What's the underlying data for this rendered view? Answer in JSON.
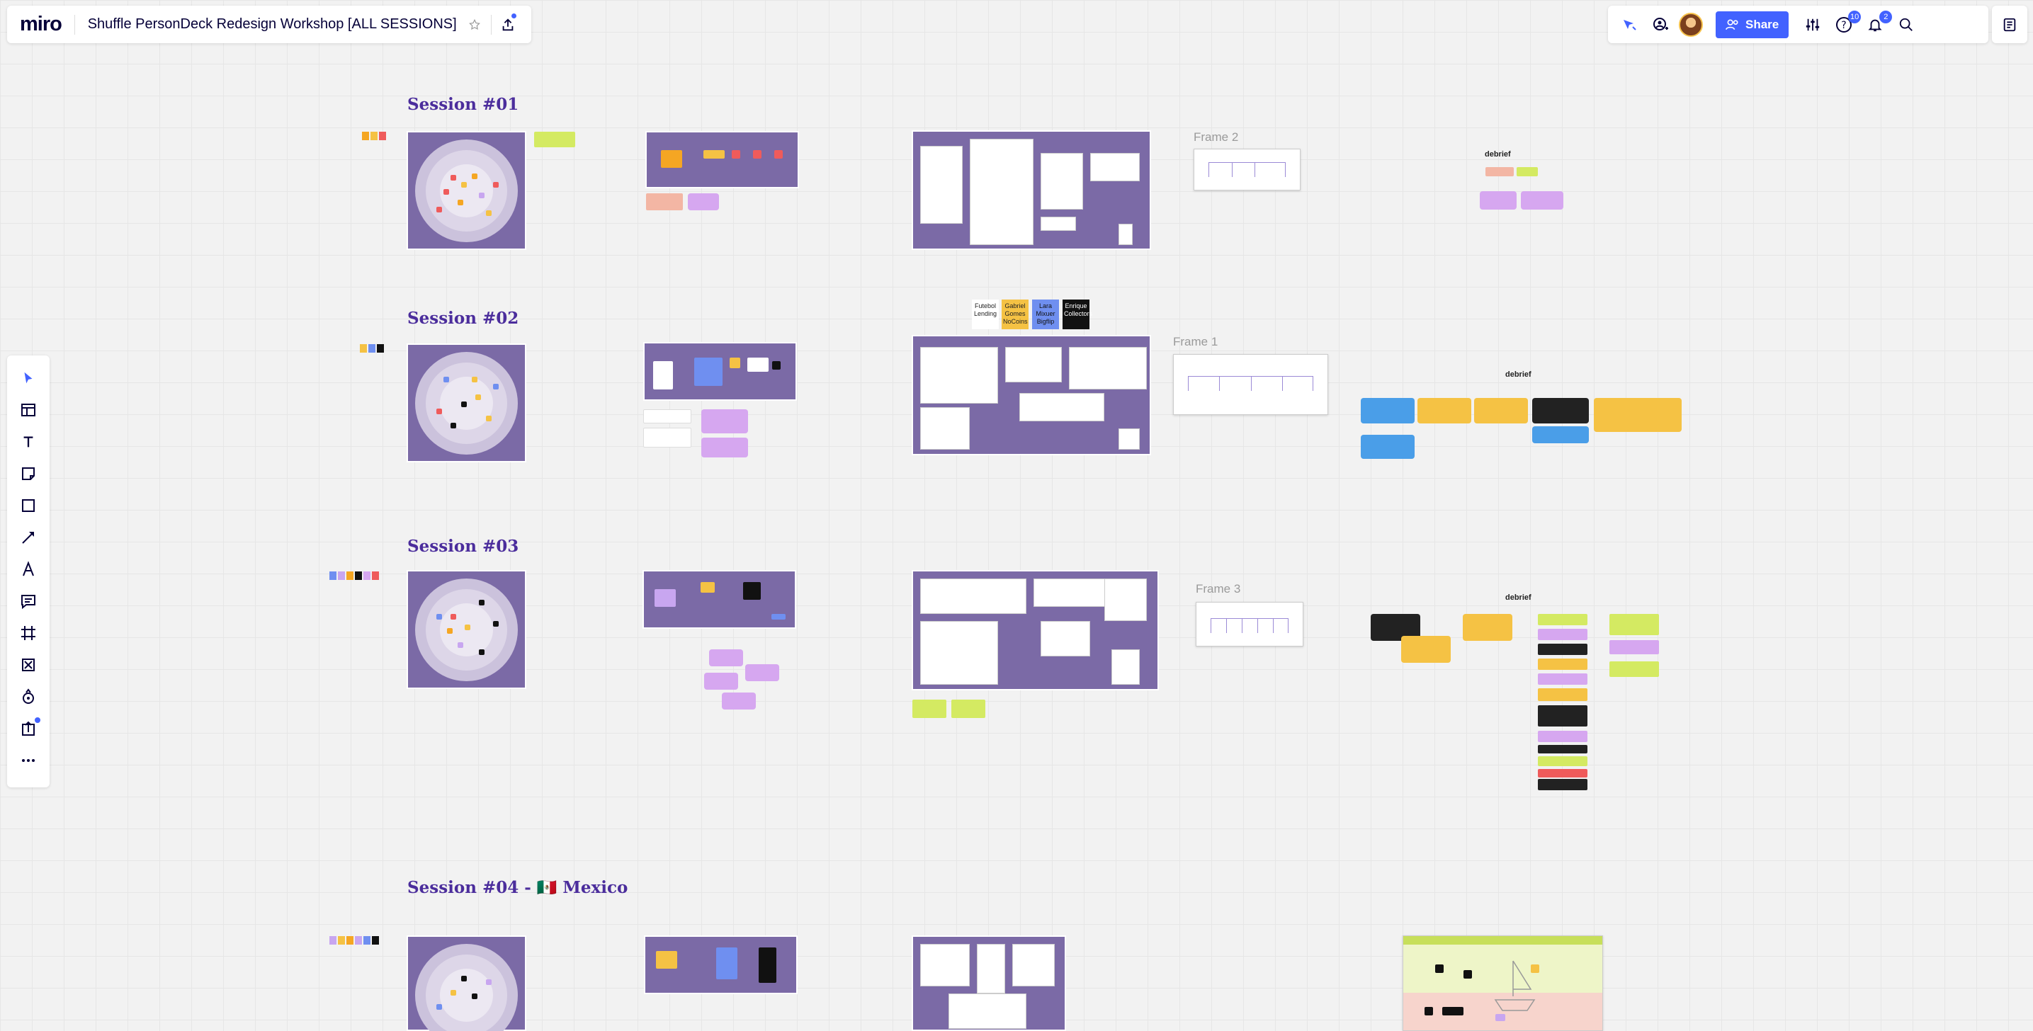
{
  "app": {
    "logo": "miro",
    "board_title": "Shuffle PersonDeck Redesign Workshop [ALL SESSIONS]"
  },
  "header_right": {
    "share_label": "Share",
    "help_badge": "10",
    "notifications_badge": "2"
  },
  "sessions": [
    {
      "title": "Session #01"
    },
    {
      "title": "Session #02"
    },
    {
      "title": "Session #03"
    },
    {
      "title": "Session #04 - 🇲🇽 Mexico"
    }
  ],
  "frames": {
    "frame2": "Frame 2",
    "frame1": "Frame 1",
    "frame3": "Frame 3"
  },
  "debrief_labels": {
    "d1": "debrief",
    "d2": "debrief",
    "d3": "debrief"
  },
  "persona_tags": [
    {
      "text": "Futebol Lending",
      "color": "#ffffff",
      "fg": "#222"
    },
    {
      "text": "Gabriel Gomes NoCoins",
      "color": "#f5c244",
      "fg": "#222"
    },
    {
      "text": "Lara Mixuer Bigflip",
      "color": "#6f8ff0",
      "fg": "#111"
    },
    {
      "text": "Enrique Collectors",
      "color": "#111111",
      "fg": "#fff"
    }
  ],
  "colors": {
    "accent": "#4262ff",
    "session_title": "#4b2d9c",
    "frame_purple": "#7b6aa6"
  },
  "icons": {
    "toolbar": [
      "select-icon",
      "templates-icon",
      "text-icon",
      "sticky-note-icon",
      "shape-icon",
      "connector-icon",
      "pen-icon",
      "comment-icon",
      "frame-icon",
      "crop-icon",
      "apps-icon",
      "upload-icon",
      "more-icon"
    ]
  }
}
